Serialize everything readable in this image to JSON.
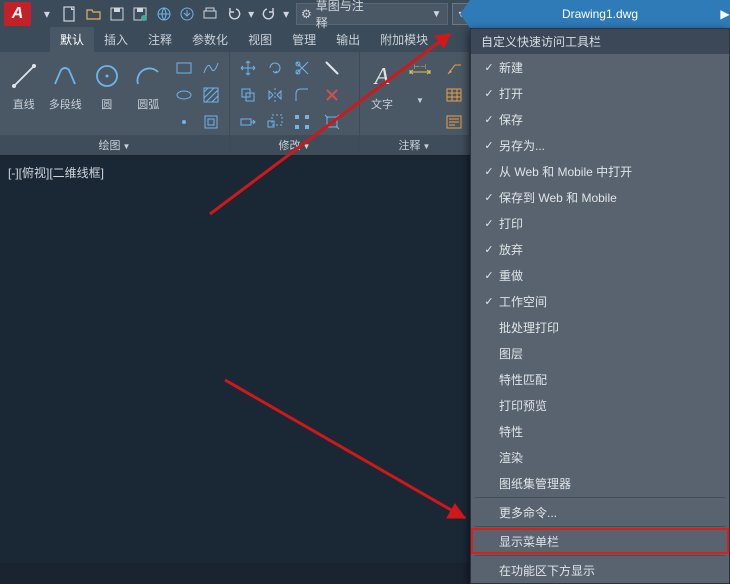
{
  "title_file": "Drawing1.dwg",
  "workspace": {
    "label": "草图与注释"
  },
  "tabs": {
    "t0": "默认",
    "t1": "插入",
    "t2": "注释",
    "t3": "参数化",
    "t4": "视图",
    "t5": "管理",
    "t6": "输出",
    "t7": "附加模块"
  },
  "draw": {
    "line": "直线",
    "polyline": "多段线",
    "circle": "圆",
    "arc": "圆弧",
    "title": "绘图"
  },
  "modify": {
    "title": "修改"
  },
  "annot": {
    "text": "文字",
    "title": "注释"
  },
  "viewport": "[-][俯视][二维线框]",
  "menu": {
    "header": "自定义快速访问工具栏",
    "m0": "新建",
    "m1": "打开",
    "m2": "保存",
    "m3": "另存为...",
    "m4": "从 Web 和 Mobile 中打开",
    "m5": "保存到 Web 和 Mobile",
    "m6": "打印",
    "m7": "放弃",
    "m8": "重做",
    "m9": "工作空间",
    "m10": "批处理打印",
    "m11": "图层",
    "m12": "特性匹配",
    "m13": "打印预览",
    "m14": "特性",
    "m15": "渲染",
    "m16": "图纸集管理器",
    "m17": "更多命令...",
    "m18": "显示菜单栏",
    "m19": "在功能区下方显示"
  }
}
